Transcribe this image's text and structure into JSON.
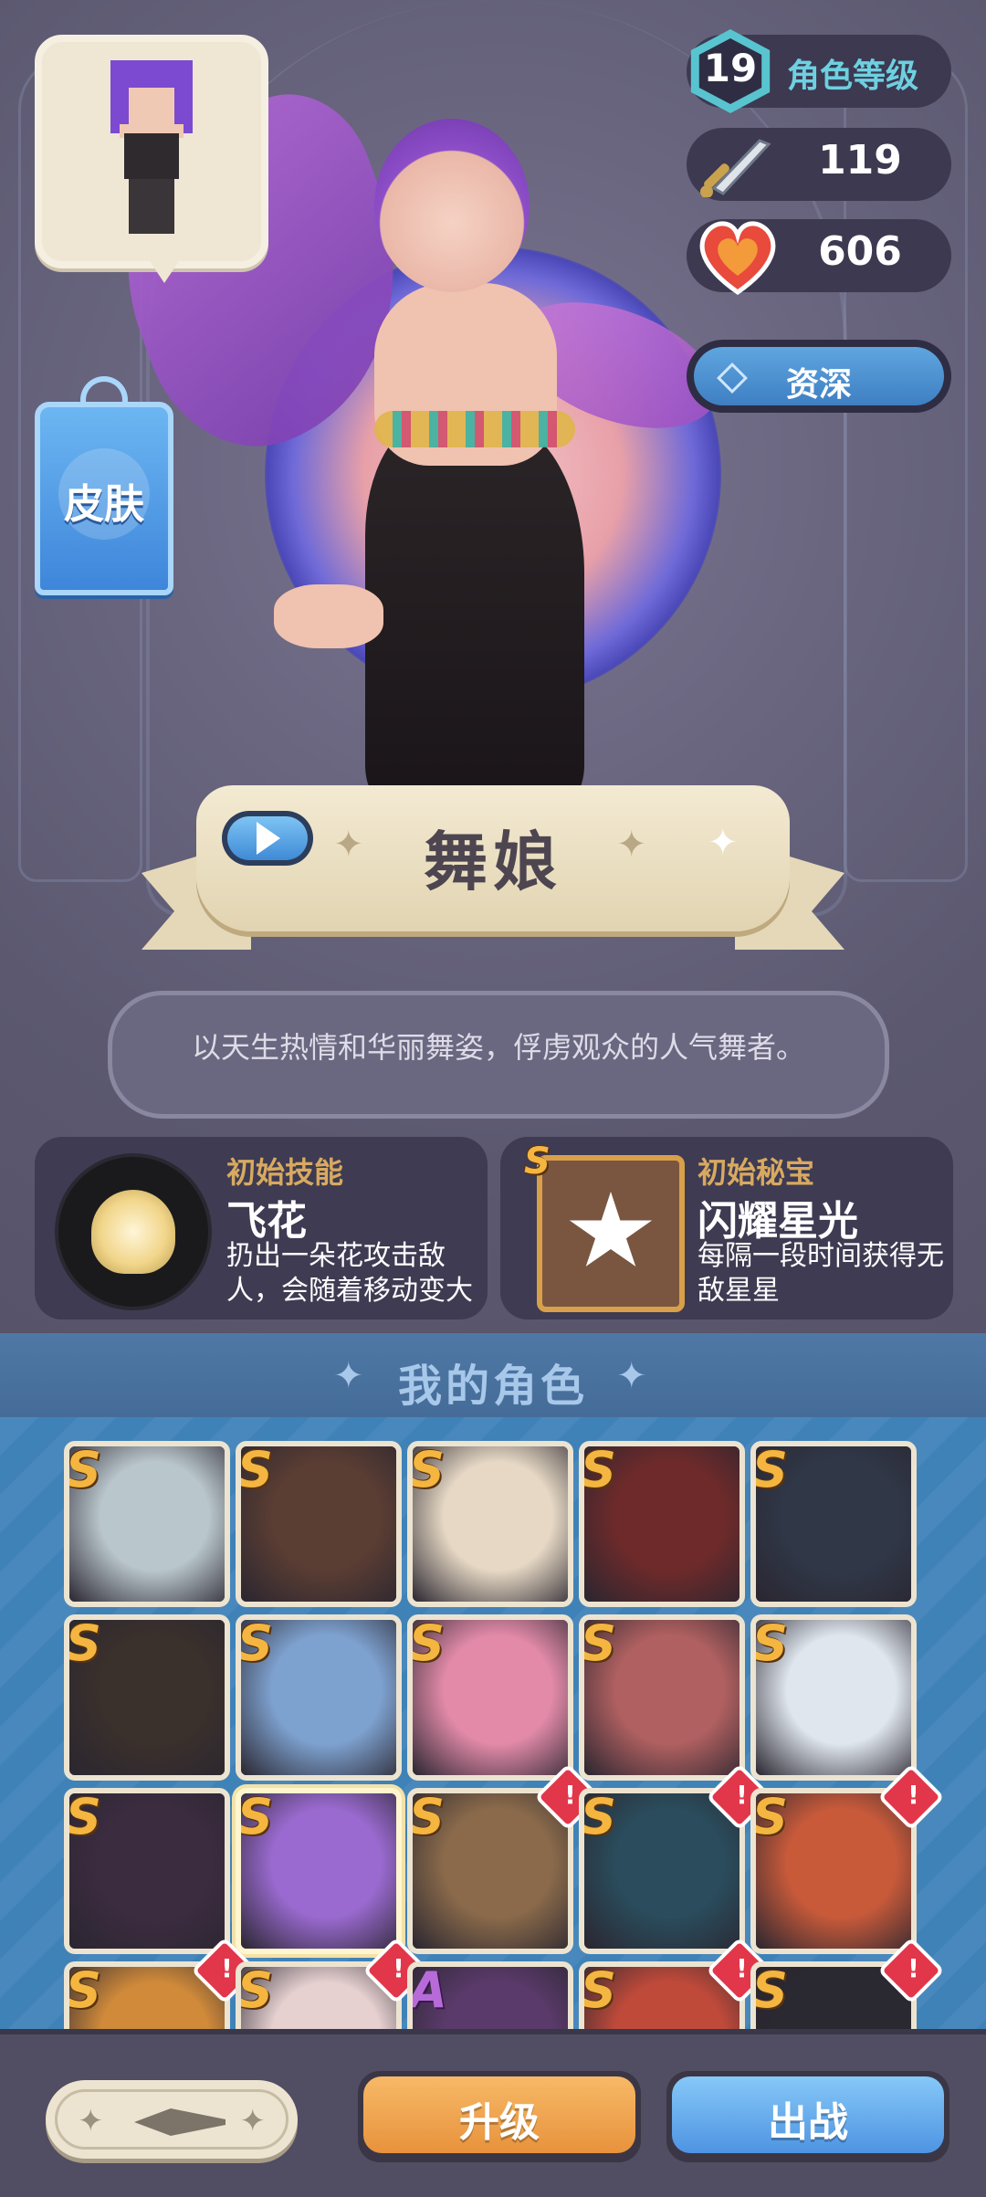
{
  "stats": {
    "level": "19",
    "level_label": "角色等级",
    "attack": "119",
    "health": "606",
    "rank": "资深"
  },
  "skin_button": {
    "label": "皮肤"
  },
  "character": {
    "name": "舞娘",
    "description": "以天生热情和华丽舞姿，俘虏观众的人气舞者。"
  },
  "skill_card": {
    "title": "初始技能",
    "name": "飞花",
    "desc": "扔出一朵花攻击敌人，会随着移动变大"
  },
  "treasure_card": {
    "grade": "S",
    "title": "初始秘宝",
    "name": "闪耀星光",
    "desc": "每隔一段时间获得无敌星星"
  },
  "my_characters": {
    "title": "我的角色",
    "tiles": [
      {
        "grade": "S",
        "color": "#b9c6cc",
        "alert": false,
        "selected": false
      },
      {
        "grade": "S",
        "color": "#5a3d33",
        "alert": false,
        "selected": false
      },
      {
        "grade": "S",
        "color": "#e6d8c4",
        "alert": false,
        "selected": false
      },
      {
        "grade": "S",
        "color": "#6e2a2a",
        "alert": false,
        "selected": false
      },
      {
        "grade": "S",
        "color": "#303848",
        "alert": false,
        "selected": false
      },
      {
        "grade": "S",
        "color": "#3a302c",
        "alert": false,
        "selected": false
      },
      {
        "grade": "S",
        "color": "#7ea2d0",
        "alert": false,
        "selected": false
      },
      {
        "grade": "S",
        "color": "#e28aa8",
        "alert": false,
        "selected": false
      },
      {
        "grade": "S",
        "color": "#b06060",
        "alert": false,
        "selected": false
      },
      {
        "grade": "S",
        "color": "#dfe6ee",
        "alert": false,
        "selected": false
      },
      {
        "grade": "S",
        "color": "#3c2c40",
        "alert": false,
        "selected": false
      },
      {
        "grade": "S",
        "color": "#9a6ad0",
        "alert": false,
        "selected": true
      },
      {
        "grade": "S",
        "color": "#8a6a4a",
        "alert": true,
        "selected": false
      },
      {
        "grade": "S",
        "color": "#2a4c5c",
        "alert": true,
        "selected": false
      },
      {
        "grade": "S",
        "color": "#c85a3a",
        "alert": true,
        "selected": false
      },
      {
        "grade": "S",
        "color": "#d08a3a",
        "alert": true,
        "selected": false
      },
      {
        "grade": "S",
        "color": "#e6d0d0",
        "alert": true,
        "selected": false
      },
      {
        "grade": "A",
        "color": "#5a3a6a",
        "alert": false,
        "selected": false
      },
      {
        "grade": "S",
        "color": "#c04a3a",
        "alert": true,
        "selected": false
      },
      {
        "grade": "S",
        "color": "#2a2830",
        "alert": true,
        "selected": false
      }
    ]
  },
  "bottom_bar": {
    "upgrade_label": "升级",
    "battle_label": "出战"
  },
  "icons": {
    "sword": "sword-icon",
    "heart": "heart-icon",
    "play": "play-icon",
    "star": "star-icon",
    "lotus": "lotus-icon",
    "alert": "exclamation-icon"
  },
  "colors": {
    "accent_blue": "#4e94e2",
    "accent_orange": "#e8923c",
    "gold_text": "#d8a960",
    "cyan_text": "#6ed0e0"
  }
}
